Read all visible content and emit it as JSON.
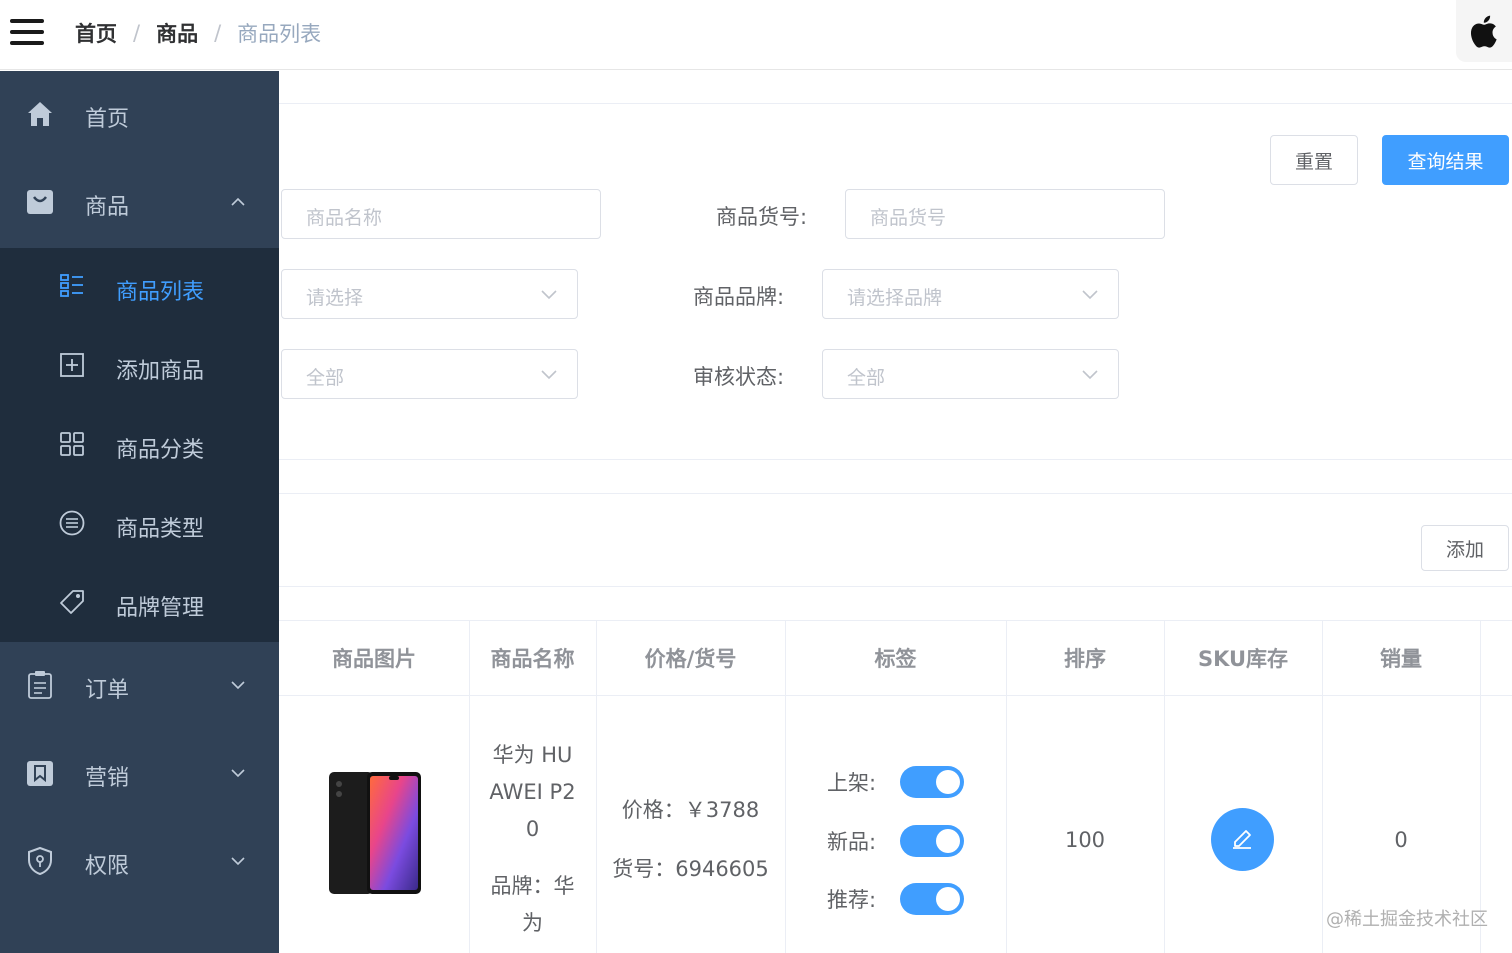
{
  "breadcrumb": {
    "home": "首页",
    "section": "商品",
    "current": "商品列表",
    "separator": "/"
  },
  "sidebar": {
    "items": [
      {
        "label": "首页",
        "icon": "home-icon"
      },
      {
        "label": "商品",
        "icon": "shopping-bag-icon",
        "expanded": true
      },
      {
        "label": "订单",
        "icon": "clipboard-icon"
      },
      {
        "label": "营销",
        "icon": "bookmark-icon"
      },
      {
        "label": "权限",
        "icon": "shield-icon"
      }
    ],
    "submenu": [
      {
        "label": "商品列表",
        "icon": "list-icon",
        "active": true
      },
      {
        "label": "添加商品",
        "icon": "plus-square-icon"
      },
      {
        "label": "商品分类",
        "icon": "grid-icon"
      },
      {
        "label": "商品类型",
        "icon": "list-circle-icon"
      },
      {
        "label": "品牌管理",
        "icon": "tag-icon"
      }
    ]
  },
  "filter": {
    "reset_label": "重置",
    "query_label": "查询结果",
    "name_placeholder": "商品名称",
    "sn_label": "商品货号:",
    "sn_placeholder": "商品货号",
    "category_placeholder": "请选择",
    "brand_label": "商品品牌:",
    "brand_placeholder": "请选择品牌",
    "status_placeholder": "全部",
    "audit_label": "审核状态:",
    "audit_placeholder": "全部"
  },
  "toolbar": {
    "add_label": "添加"
  },
  "table": {
    "headers": [
      "商品图片",
      "商品名称",
      "价格/货号",
      "标签",
      "排序",
      "SKU库存",
      "销量"
    ],
    "row": {
      "name_lines": [
        "华为 HU",
        "AWEI P2",
        "0"
      ],
      "brand_lines": [
        "品牌：华",
        "为"
      ],
      "price": "价格：￥3788",
      "sn": "货号：6946605",
      "tags": [
        {
          "label": "上架:",
          "on": true
        },
        {
          "label": "新品:",
          "on": true
        },
        {
          "label": "推荐:",
          "on": true
        }
      ],
      "sort": "100",
      "sales": "0"
    }
  },
  "watermark": "@稀土掘金技术社区",
  "colors": {
    "sidebar": "#304156",
    "submenu": "#1f2d3d",
    "accent": "#409eff"
  }
}
